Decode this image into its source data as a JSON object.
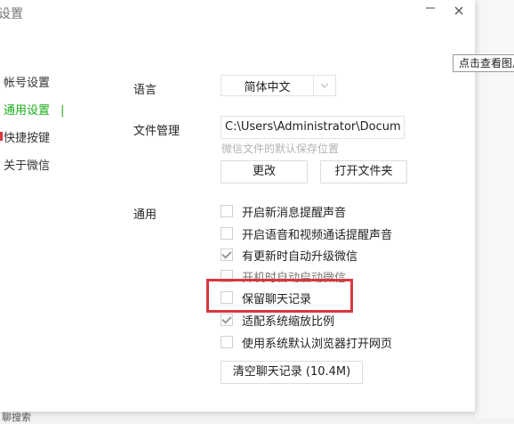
{
  "window": {
    "title": "设置",
    "minimize_icon": "minimize-icon",
    "close_icon": "close-icon"
  },
  "tooltip": {
    "text": "点击查看图片"
  },
  "sidebar": {
    "items": [
      {
        "label": "帐号设置",
        "active": false
      },
      {
        "label": "通用设置",
        "active": true
      },
      {
        "label": "快捷按键",
        "active": false
      },
      {
        "label": "关于微信",
        "active": false
      }
    ]
  },
  "language": {
    "label": "语言",
    "value": "简体中文",
    "dropdown_icon": "chevron-down-icon"
  },
  "file_management": {
    "label": "文件管理",
    "path": "C:\\Users\\Administrator\\Docum",
    "hint": "微信文件的默认保存位置",
    "change_button": "更改",
    "open_folder_button": "打开文件夹"
  },
  "general": {
    "label": "通用",
    "options": [
      {
        "label": "开启新消息提醒声音",
        "checked": false
      },
      {
        "label": "开启语音和视频通话提醒声音",
        "checked": false
      },
      {
        "label": "有更新时自动升级微信",
        "checked": true
      },
      {
        "label": "开机时自动启动微信",
        "checked": false
      },
      {
        "label": "保留聊天记录",
        "checked": false
      },
      {
        "label": "适配系统缩放比例",
        "checked": true
      },
      {
        "label": "使用系统默认浏览器打开网页",
        "checked": false
      }
    ],
    "clear_button": "清空聊天记录 (10.4M)"
  },
  "colors": {
    "accent": "#1aad19",
    "highlight": "#d9363e"
  },
  "bottom_fragment": "聊搜索"
}
